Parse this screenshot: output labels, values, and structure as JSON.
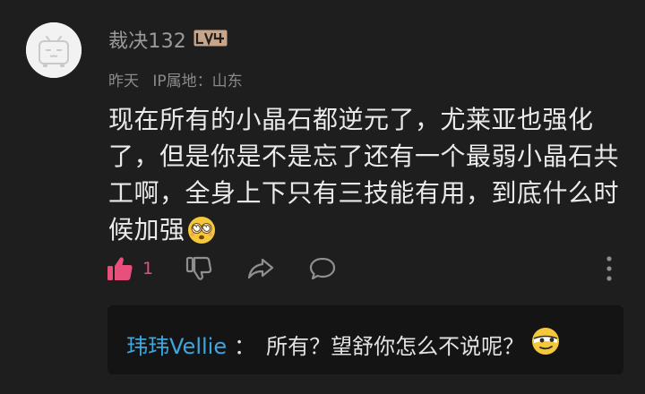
{
  "comment": {
    "username": "裁决132",
    "level_badge": "LV4",
    "time": "昨天",
    "ip_location": "IP属地：山东",
    "text": "现在所有的小晶石都逆元了，尤莱亚也强化了，但是你是不是忘了还有一个最弱小晶石共工啊，全身上下只有三技能有用，到底什么时候加强",
    "trailing_emoji": "dizzy-face-emoji",
    "like_count": "1"
  },
  "reply": {
    "name": "玮玮Vellie",
    "separator": "：",
    "text": "所有？望舒你怎么不说呢？",
    "trailing_emoji": "sly-face-emoji"
  },
  "colors": {
    "background": "#1e1e1f",
    "like_accent": "#e7507a",
    "link_blue": "#3ea6df",
    "badge": "#c7a58a"
  }
}
